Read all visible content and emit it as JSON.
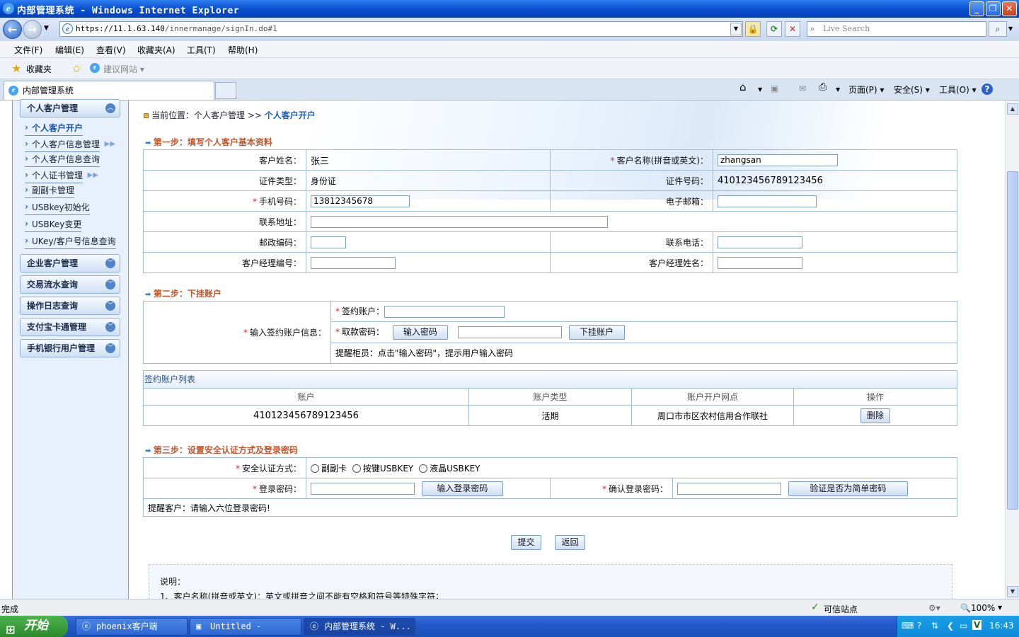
{
  "window": {
    "title": "内部管理系统 - Windows Internet Explorer"
  },
  "address": {
    "scheme": "https://",
    "host": "11.1.63.140",
    "path": "/innermanage/signIn.do#1",
    "search_placeholder": "Live Search"
  },
  "menu": [
    "文件(F)",
    "编辑(E)",
    "查看(V)",
    "收藏夹(A)",
    "工具(T)",
    "帮助(H)"
  ],
  "favorites": {
    "label": "收藏夹",
    "suggested": "建议网站 ▾"
  },
  "tab": {
    "title": "内部管理系统"
  },
  "commandbar": {
    "page": "页面(P) ▾",
    "safety": "安全(S) ▾",
    "tools": "工具(O) ▾"
  },
  "sidebar": {
    "group1": "个人客户管理",
    "items": [
      "个人客户开户",
      "个人客户信息管理",
      "个人客户信息查询",
      "个人证书管理",
      "副副卡管理",
      "USBkey初始化",
      "USBKey变更",
      "UKey/客户号信息查询"
    ],
    "groups": [
      "企业客户管理",
      "交易流水查询",
      "操作日志查询",
      "支付宝卡通管理",
      "手机银行用户管理"
    ]
  },
  "breadcrumb": {
    "prefix": "当前位置：个人客户管理  >> ",
    "current": "个人客户开户"
  },
  "step1": {
    "title": "第一步：填写个人客户基本资料",
    "name_label": "客户姓名：",
    "name_value": "张三",
    "ename_label": "客户名称(拼音或英文)：",
    "ename_value": "zhangsan",
    "idtype_label": "证件类型：",
    "idtype_value": "身份证",
    "idno_label": "证件号码：",
    "idno_value": "410123456789123456",
    "mobile_label": "手机号码：",
    "mobile_value": "13812345678",
    "email_label": "电子邮箱：",
    "address_label": "联系地址：",
    "zip_label": "邮政编码：",
    "phone_label": "联系电话：",
    "mgrno_label": "客户经理编号：",
    "mgrname_label": "客户经理姓名："
  },
  "step2": {
    "title": "第二步：下挂账户",
    "info_label": "输入签约账户信息：",
    "account_label": "签约账户：",
    "pwd_label": "取款密码：",
    "pwd_button": "输入密码",
    "attach_button": "下挂账户",
    "hint": "提醒柜员：点击\"输入密码\"，提示用户输入密码"
  },
  "list": {
    "caption": "签约账户列表",
    "headers": [
      "账户",
      "账户类型",
      "账户开户网点",
      "操作"
    ],
    "rows": [
      {
        "account": "410123456789123456",
        "type": "活期",
        "branch": "周口市市区农村信用合作联社",
        "action": "删除"
      }
    ]
  },
  "step3": {
    "title": "第三步：设置安全认证方式及登录密码",
    "auth_label": "安全认证方式：",
    "options": [
      "副副卡",
      "按键USBKEY",
      "液晶USBKEY"
    ],
    "login_label": "登录密码：",
    "login_button": "输入登录密码",
    "confirm_label": "确认登录密码：",
    "check_button": "验证是否为简单密码",
    "hint": "提醒客户：请输入六位登录密码!"
  },
  "actions": {
    "submit": "提交",
    "back": "返回"
  },
  "notes": {
    "title": "说明：",
    "line1": "1、客户名称(拼音或英文)：英文或拼音之间不能有空格和符号等特殊字符；"
  },
  "status": {
    "left": "完成",
    "zone": "可信站点",
    "zoom": "100%"
  },
  "taskbar": {
    "start": "开始",
    "tasks": [
      "phoenix客户端",
      "Untitled - IDCheck",
      "内部管理系统 - W..."
    ],
    "clock": "16:43"
  },
  "colors": {
    "accent": "#1d5fb4",
    "step_title": "#c0552a",
    "required": "#dd2233"
  }
}
